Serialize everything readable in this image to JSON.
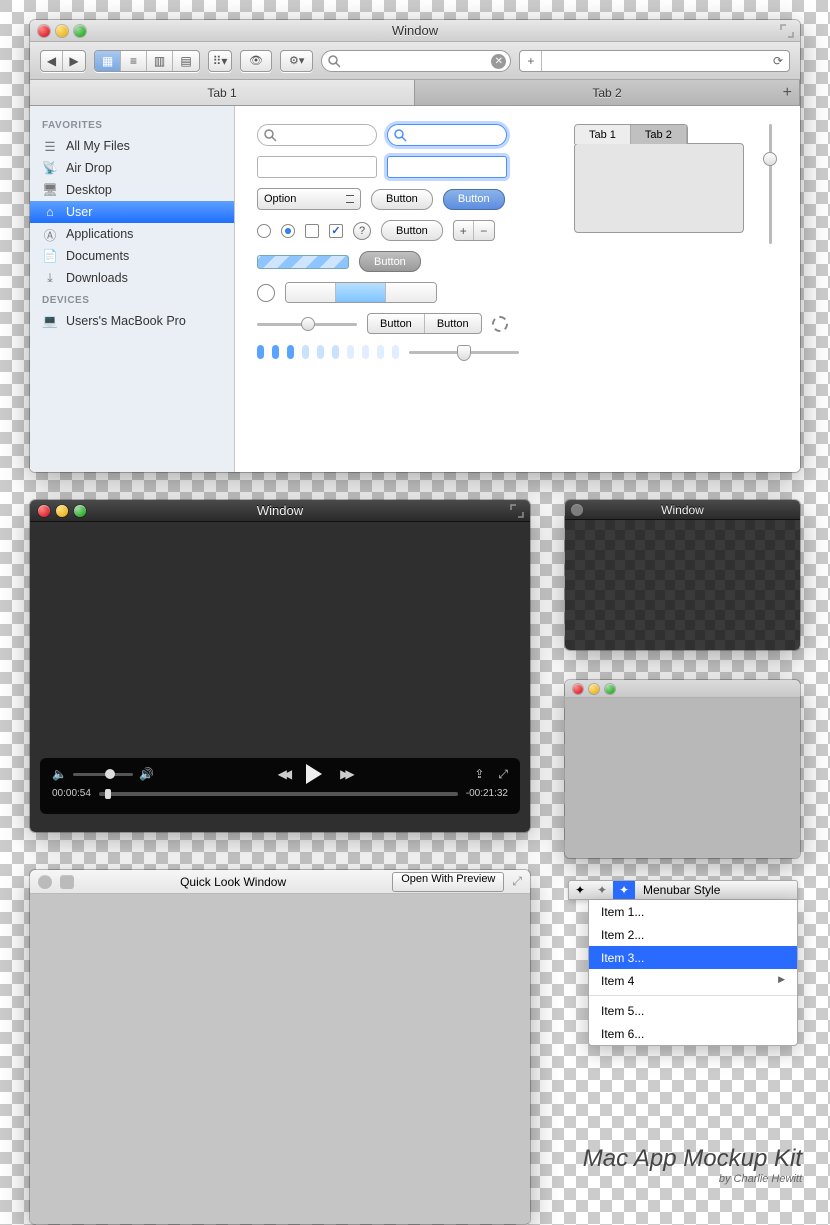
{
  "main_window": {
    "title": "Window",
    "tabs": [
      "Tab 1",
      "Tab 2"
    ],
    "sidebar": {
      "favorites_label": "FAVORITES",
      "devices_label": "DEVICES",
      "items": [
        {
          "label": "All My Files",
          "icon": "all-files"
        },
        {
          "label": "Air Drop",
          "icon": "airdrop"
        },
        {
          "label": "Desktop",
          "icon": "desktop"
        },
        {
          "label": "User",
          "icon": "home",
          "active": true
        },
        {
          "label": "Applications",
          "icon": "apps"
        },
        {
          "label": "Documents",
          "icon": "docs"
        },
        {
          "label": "Downloads",
          "icon": "downloads"
        }
      ],
      "devices": [
        {
          "label": "Users's MacBook Pro"
        }
      ]
    },
    "controls": {
      "option_label": "Option",
      "button_label": "Button",
      "mini_tabs": [
        "Tab 1",
        "Tab 2"
      ]
    }
  },
  "video_window": {
    "title": "Window",
    "time_elapsed": "00:00:54",
    "time_remaining": "-00:21:32"
  },
  "small_dark_window": {
    "title": "Window"
  },
  "quicklook": {
    "title": "Quick Look Window",
    "open_button": "Open With Preview"
  },
  "menubar": {
    "label": "Menubar Style",
    "items": [
      "Item 1...",
      "Item 2...",
      "Item 3...",
      "Item 4",
      "Item 5...",
      "Item 6..."
    ]
  },
  "footer": {
    "title": "Mac App Mockup Kit",
    "by": "by Charlie Hewitt"
  }
}
